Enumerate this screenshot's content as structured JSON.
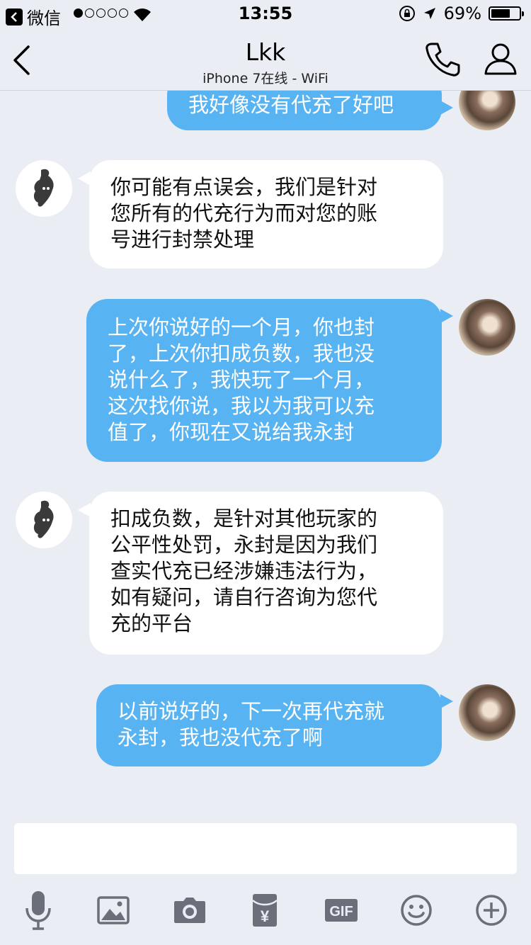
{
  "status_bar": {
    "back_app": "微信",
    "signal_dots": 5,
    "signal_filled": 1,
    "time": "13:55",
    "battery_text": "69%",
    "battery_level": 0.69
  },
  "header": {
    "title": "Lkk",
    "subtitle": "iPhone 7在线 - WiFi"
  },
  "messages": [
    {
      "from": "me",
      "text": "我好像没有代充了好吧"
    },
    {
      "from": "them",
      "text": "你可能有点误会，我们是针对\n您所有的代充行为而对您的账\n号进行封禁处理"
    },
    {
      "from": "me",
      "text": "上次你说好的一个月，你也封\n了，上次你扣成负数，我也没\n说什么了，我快玩了一个月，\n这次找你说，我以为我可以充\n值了，你现在又说给我永封"
    },
    {
      "from": "them",
      "text": "扣成负数，是针对其他玩家的\n公平性处罚，永封是因为我们\n查实代充已经涉嫌违法行为，\n如有疑问，请自行咨询为您代\n充的平台"
    },
    {
      "from": "me",
      "text": "以前说好的，下一次再代充就\n永封，我也没代充了啊"
    }
  ],
  "input": {
    "placeholder": ""
  },
  "toolbar": {
    "icons": [
      "microphone-icon",
      "image-icon",
      "camera-icon",
      "red-packet-icon",
      "gif-icon",
      "emoji-icon",
      "plus-icon"
    ],
    "gif_label": "GIF",
    "packet_symbol": "¥"
  },
  "colors": {
    "background": "#ebedf5",
    "outgoing_bubble": "#58b3f2",
    "incoming_bubble": "#ffffff",
    "icon_gray": "#6b6f7a"
  }
}
